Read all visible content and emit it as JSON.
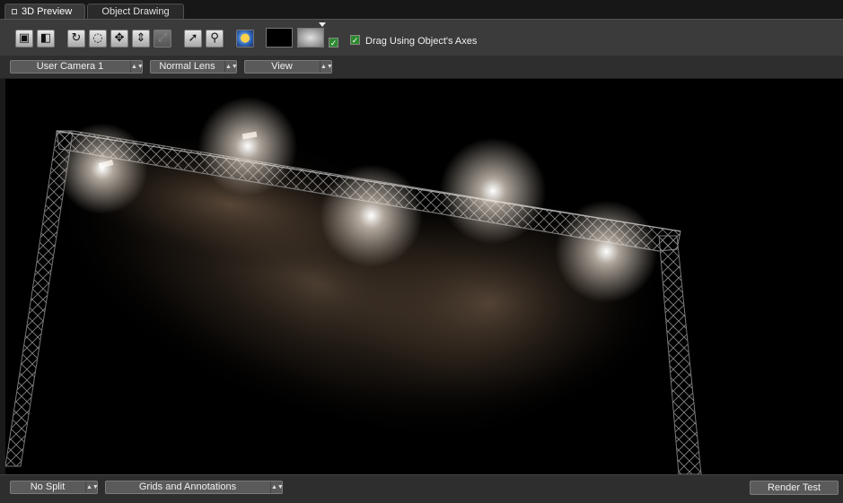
{
  "tabs": [
    {
      "label": "3D Preview",
      "active": true
    },
    {
      "label": "Object Drawing",
      "active": false
    }
  ],
  "toolbar": {
    "drag_axes_label": "Drag Using Object's Axes",
    "drag_axes_checked": true,
    "background_checked": true
  },
  "viewbar": {
    "camera": "User Camera 1",
    "lens": "Normal Lens",
    "view": "View"
  },
  "bottombar": {
    "split": "No Split",
    "grids": "Grids and Annotations",
    "render_test": "Render Test"
  }
}
